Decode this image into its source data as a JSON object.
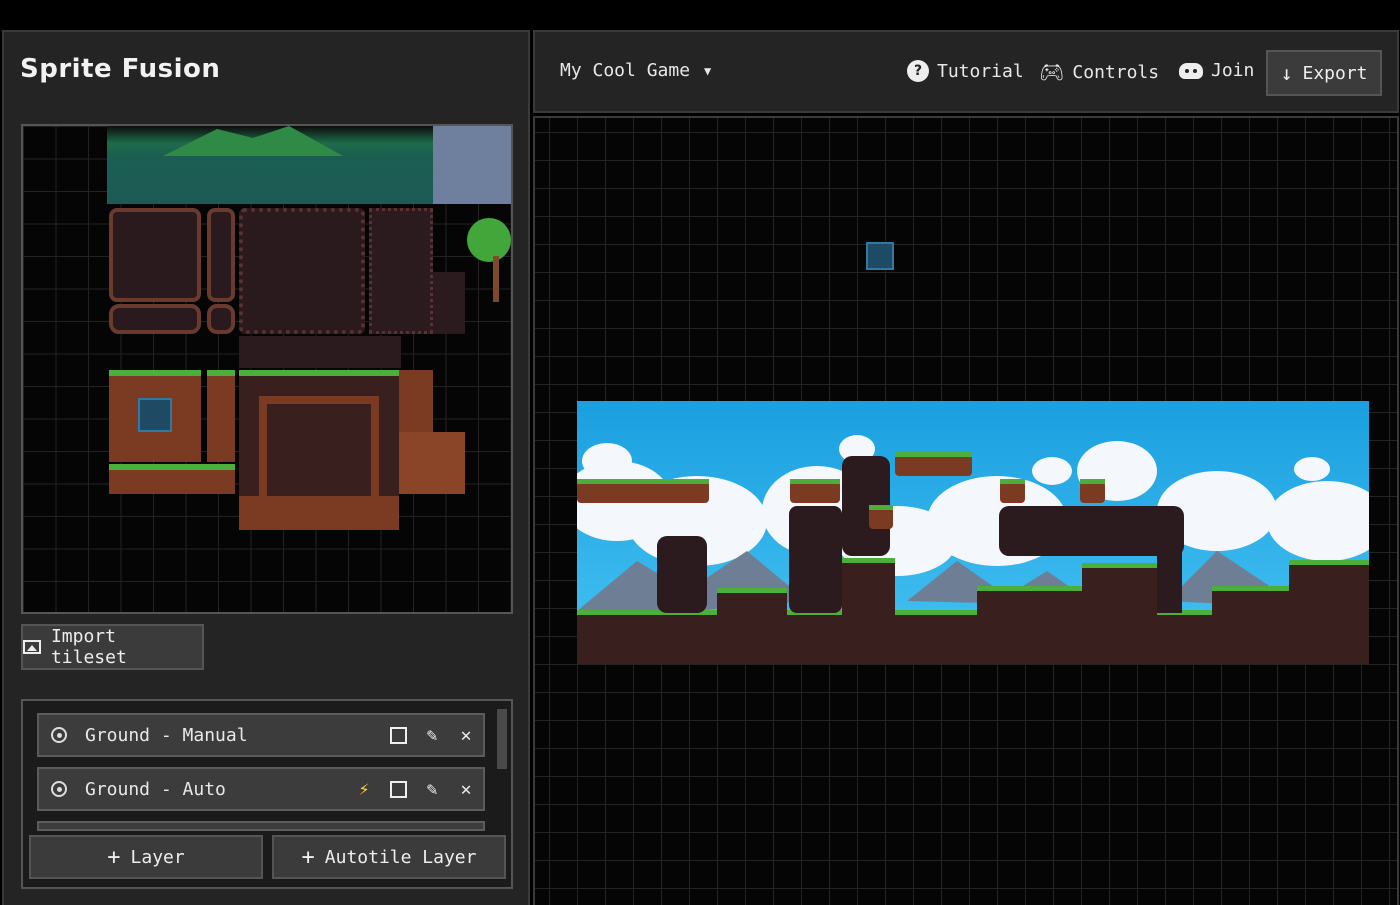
{
  "app": {
    "title": "Sprite Fusion"
  },
  "tileset": {
    "import_label": "Import tileset",
    "import_icon": "image-icon"
  },
  "layers": {
    "items": [
      {
        "name": "Ground - Manual",
        "autotile": false
      },
      {
        "name": "Ground - Auto",
        "autotile": true
      }
    ],
    "add_layer_label": "Layer",
    "add_autotile_label": "Autotile Layer"
  },
  "topbar": {
    "project_name": "My Cool Game",
    "tutorial_label": "Tutorial",
    "controls_label": "Controls",
    "join_label": "Join",
    "export_label": "Export"
  },
  "colors": {
    "panel": "#242424",
    "border": "#3a3a3a",
    "button": "#3b3b3b",
    "selection": "#1f4a63",
    "sky": "#1a9fe0",
    "dirt": "#3a1f1f",
    "grass": "#4caf3c"
  }
}
